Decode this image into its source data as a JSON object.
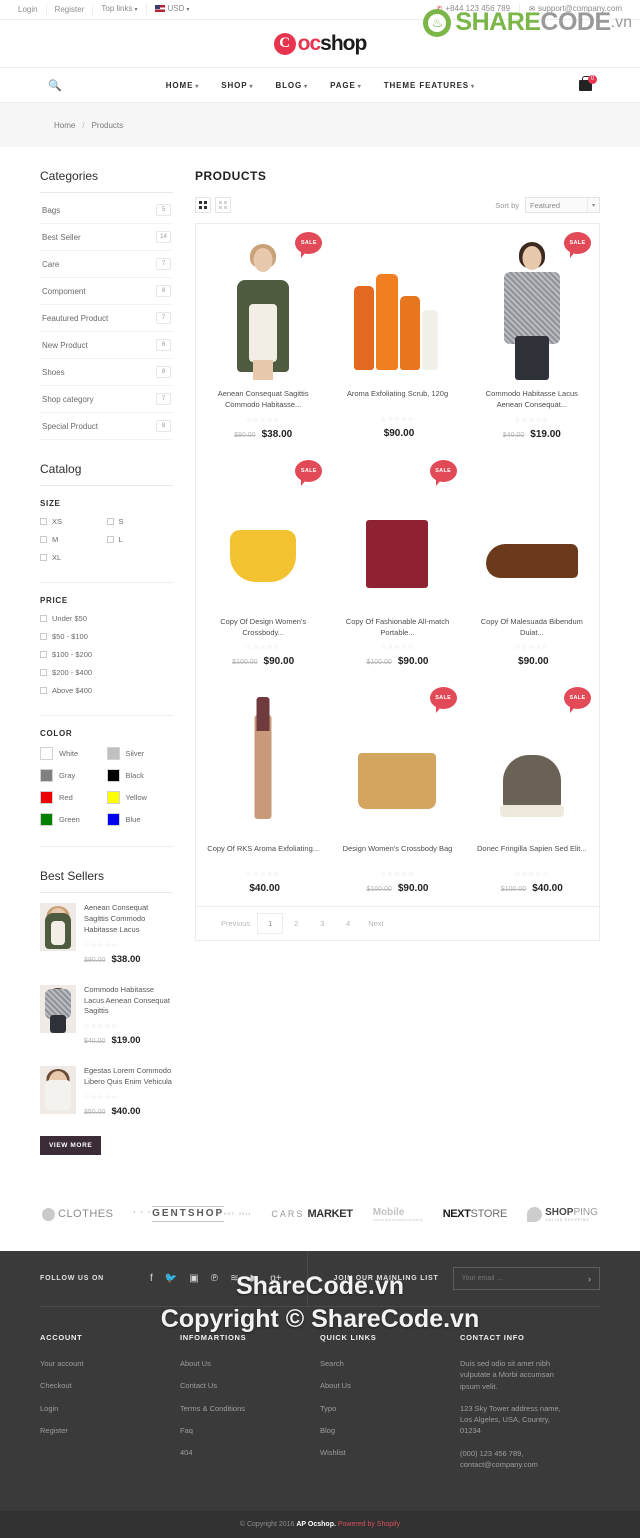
{
  "topbar": {
    "links": [
      "Login",
      "Register",
      "Top links"
    ],
    "currency": "USD",
    "phone": "+844 123 456 789",
    "email": "support@company.com"
  },
  "logo": {
    "mark": "C",
    "part1": "oc",
    "part2": "shop"
  },
  "nav": {
    "search_icon": "search-icon",
    "items": [
      "HOME",
      "SHOP",
      "BLOG",
      "PAGE",
      "THEME FEATURES"
    ],
    "cart_count": "0"
  },
  "breadcrumb": {
    "home": "Home",
    "sep": "/",
    "current": "Products"
  },
  "sidebar": {
    "categories_title": "Categories",
    "categories": [
      {
        "label": "Bags",
        "count": "5"
      },
      {
        "label": "Best Seller",
        "count": "14"
      },
      {
        "label": "Care",
        "count": "7"
      },
      {
        "label": "Compoment",
        "count": "8"
      },
      {
        "label": "Feautured Product",
        "count": "7"
      },
      {
        "label": "New Product",
        "count": "6"
      },
      {
        "label": "Shoes",
        "count": "8"
      },
      {
        "label": "Shop category",
        "count": "7"
      },
      {
        "label": "Special Product",
        "count": "8"
      }
    ],
    "catalog_title": "Catalog",
    "size_head": "SIZE",
    "sizes": [
      "XS",
      "S",
      "M",
      "L",
      "XL"
    ],
    "price_head": "PRICE",
    "prices": [
      "Under $50",
      "$50 - $100",
      "$100 - $200",
      "$200 - $400",
      "Above $400"
    ],
    "color_head": "COLOR",
    "colors": [
      {
        "label": "White",
        "hex": "#ffffff"
      },
      {
        "label": "Silver",
        "hex": "#c0c0c0"
      },
      {
        "label": "Gray",
        "hex": "#808080"
      },
      {
        "label": "Black",
        "hex": "#000000"
      },
      {
        "label": "Red",
        "hex": "#ee0000"
      },
      {
        "label": "Yellow",
        "hex": "#ffff00"
      },
      {
        "label": "Green",
        "hex": "#008000"
      },
      {
        "label": "Blue",
        "hex": "#0000ee"
      }
    ],
    "best_title": "Best Sellers",
    "best_sellers": [
      {
        "name": "Aenean Consequat Sagittis Commodo Habitasse Lacus",
        "stars": "☆☆☆☆☆",
        "old_price": "$90.00",
        "price": "$38.00"
      },
      {
        "name": "Commodo Habitasse Lacus Aenean Consequat Sagittis",
        "stars": "☆☆☆☆☆",
        "old_price": "$40.00",
        "price": "$19.00"
      },
      {
        "name": "Egestas Lorem Commodo Libero Quis Enim Vehicula",
        "stars": "☆☆☆☆☆",
        "old_price": "$50.00",
        "price": "$40.00"
      }
    ],
    "view_more": "VIEW MORE"
  },
  "products": {
    "title": "PRODUCTS",
    "sort_label": "Sort by",
    "sort_value": "Featured",
    "sale_badge": "SALE",
    "items": [
      {
        "name": "Aenean Consequat Sagittis Commodo Habitasse...",
        "stars": "☆☆☆☆☆",
        "old_price": "$90.00",
        "price": "$38.00",
        "sale": true,
        "art": "coat"
      },
      {
        "name": "Aroma Exfoliating Scrub, 120g",
        "stars": "☆☆☆☆☆",
        "old_price": "",
        "price": "$90.00",
        "sale": false,
        "art": "bottles"
      },
      {
        "name": "Commodo Habitasse Lacus Aenean Consequat...",
        "stars": "☆☆☆☆☆",
        "old_price": "$40.00",
        "price": "$19.00",
        "sale": true,
        "art": "blazer"
      },
      {
        "name": "Copy Of Design Women's Crossbody...",
        "stars": "☆☆☆☆☆",
        "old_price": "$100.00",
        "price": "$90.00",
        "sale": true,
        "art": "yellowbag"
      },
      {
        "name": "Copy Of Fashionable All-match Portable...",
        "stars": "☆☆☆☆☆",
        "old_price": "$100.00",
        "price": "$90.00",
        "sale": true,
        "art": "redbag"
      },
      {
        "name": "Copy Of Malesuada Bibendum Duiat...",
        "stars": "☆☆☆☆☆",
        "old_price": "",
        "price": "$90.00",
        "sale": false,
        "art": "shoe"
      },
      {
        "name": "Copy Of RKS Aroma Exfoliating...",
        "stars": "☆☆☆☆☆",
        "old_price": "",
        "price": "$40.00",
        "sale": false,
        "art": "lipstick"
      },
      {
        "name": "Design Women's Crossbody Bag",
        "stars": "☆☆☆☆☆",
        "old_price": "$100.00",
        "price": "$90.00",
        "sale": true,
        "art": "satchel"
      },
      {
        "name": "Donec Fringilla Sapien Sed Elit...",
        "stars": "☆☆☆☆☆",
        "old_price": "$100.00",
        "price": "$40.00",
        "sale": true,
        "art": "sneaker"
      }
    ],
    "pagination": {
      "previous": "Previous",
      "pages": [
        "1",
        "2",
        "3",
        "4"
      ],
      "next": "Next",
      "active": "1"
    }
  },
  "brands": [
    {
      "name": "CLOTHES"
    },
    {
      "name": "GENTSHOP",
      "top": "* * *",
      "bottom": "EST. 2011"
    },
    {
      "name": "CARS MARKET",
      "p1": "CARS",
      "p2": "MARKET"
    },
    {
      "name": "Mobile",
      "sub": "Lorem ipsum dolor sit facing"
    },
    {
      "name": "NEXTSTORE",
      "p1": "NEXT",
      "p2": "STORE"
    },
    {
      "name": "SHOPPING",
      "p1": "SHOP",
      "p2": "PING",
      "sub": "ONLINE SHOPPING"
    }
  ],
  "footer": {
    "follow_label": "FOLLOW US ON",
    "social": [
      "facebook-icon",
      "twitter-icon",
      "instagram-icon",
      "pinterest-icon",
      "rss-icon",
      "youtube-icon",
      "google-plus-icon"
    ],
    "social_glyphs": [
      "f",
      "🐦",
      "▣",
      "℗",
      "≋",
      "▶",
      "g+"
    ],
    "newsletter_label": "JOIN OUR MAINLING LIST",
    "email_placeholder": "Your email ...",
    "submit_icon": "chevron-right-icon",
    "columns": [
      {
        "head": "ACCOUNT",
        "links": [
          "Your account",
          "Checkout",
          "Login",
          "Register"
        ]
      },
      {
        "head": "INFOMARTIONS",
        "links": [
          "About Us",
          "Contact Us",
          "Terms & Conditions",
          "Faq",
          "404"
        ]
      },
      {
        "head": "QUICK LINKS",
        "links": [
          "Search",
          "About Us",
          "Typo",
          "Blog",
          "Wishlist"
        ]
      }
    ],
    "contact": {
      "head": "CONTACT INFO",
      "line1": "Duis sed odio sit amet nibh vulputate a Morbi accumsan ipsum velit.",
      "line2": "123 Sky Tower address name, Los Algeles, USA, Country, 01234",
      "line3": "(000) 123 456 789, contact@company.com"
    },
    "copyright_pre": "© Copyright 2016",
    "copyright_brand": "AP Ocshop.",
    "copyright_post": "Powered by Shopify"
  },
  "watermark": {
    "share": "SHARE",
    "code": "CODE",
    "vn": ".vn",
    "line1": "ShareCode.vn",
    "line2": "Copyright © ShareCode.vn"
  }
}
